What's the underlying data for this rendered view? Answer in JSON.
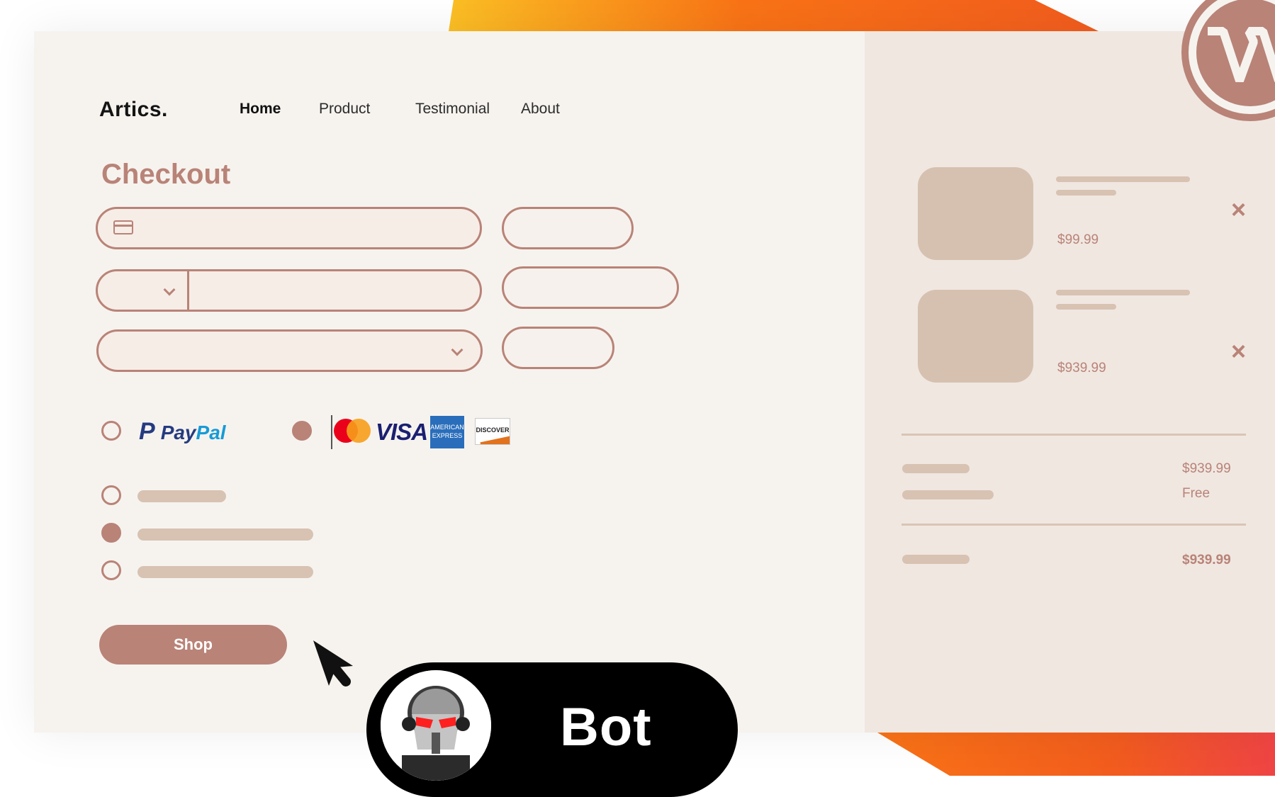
{
  "brand": {
    "logo": "Artics."
  },
  "nav": [
    {
      "label": "Home",
      "active": true
    },
    {
      "label": "Product",
      "active": false
    },
    {
      "label": "Testimonial",
      "active": false
    },
    {
      "label": "About",
      "active": false
    }
  ],
  "checkout": {
    "title": "Checkout",
    "payment_methods": [
      "PayPal",
      "MasterCard",
      "VISA",
      "AMERICAN EXPRESS",
      "DISCOVER"
    ],
    "paypal_selected": false,
    "cards_selected": true,
    "shipping_selected_index": 1,
    "shop_label": "Shop"
  },
  "cart": {
    "items": [
      {
        "price": "$99.99"
      },
      {
        "price": "$939.99"
      }
    ],
    "remove_icon": "×",
    "subtotal": "$939.99",
    "shipping": "Free",
    "total": "$939.99"
  },
  "bot": {
    "label": "Bot"
  },
  "colors": {
    "accent": "#b98377",
    "card_bg": "#f6f3ef",
    "side_bg": "#f0e7e1",
    "placeholder": "#d8c2b2",
    "orange": "#f97316"
  },
  "icons": [
    "credit-card-icon",
    "chevron-down-icon",
    "close-icon",
    "cursor-arrow-icon",
    "wordpress-icon",
    "robot-avatar"
  ]
}
